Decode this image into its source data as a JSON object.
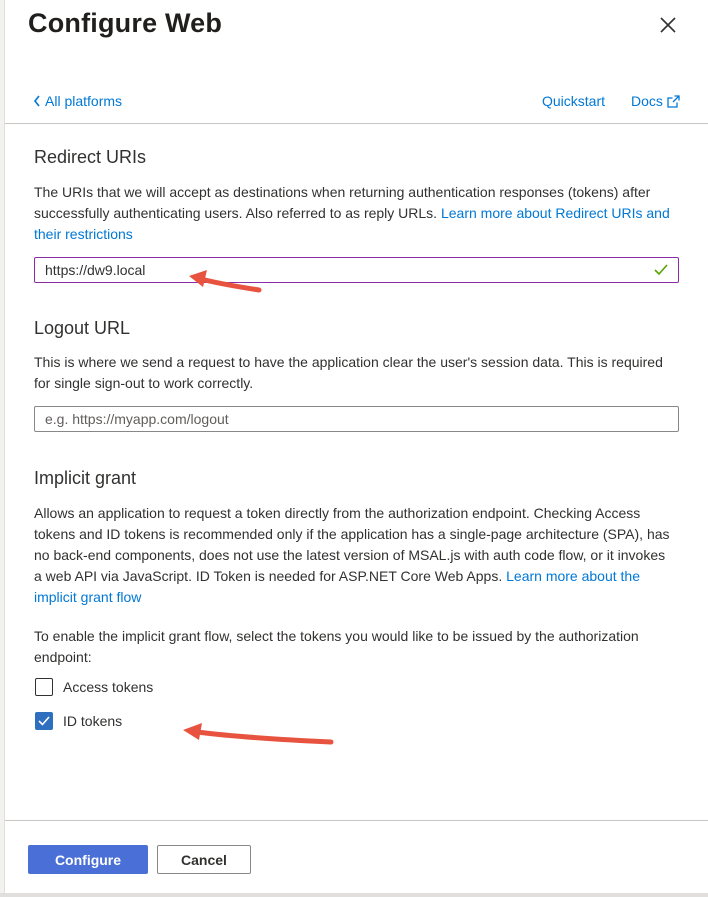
{
  "dialog": {
    "title": "Configure Web",
    "back_link": "All platforms",
    "quickstart_link": "Quickstart",
    "docs_link": "Docs"
  },
  "redirect": {
    "heading": "Redirect URIs",
    "description": "The URIs that we will accept as destinations when returning authentication responses (tokens) after successfully authenticating users. Also referred to as reply URLs. ",
    "learn_more": "Learn more about Redirect URIs and their restrictions",
    "value": "https://dw9.local"
  },
  "logout": {
    "heading": "Logout URL",
    "description": "This is where we send a request to have the application clear the user's session data. This is required for single sign-out to work correctly.",
    "placeholder": "e.g. https://myapp.com/logout"
  },
  "implicit": {
    "heading": "Implicit grant",
    "description": "Allows an application to request a token directly from the authorization endpoint. Checking Access tokens and ID tokens is recommended only if the application has a single-page architecture (SPA), has no back-end components, does not use the latest version of MSAL.js with auth code flow, or it invokes a web API via JavaScript. ID Token is needed for ASP.NET Core Web Apps. ",
    "learn_more": "Learn more about the implicit grant flow",
    "instruction": "To enable the implicit grant flow, select the tokens you would like to be issued by the authorization endpoint:",
    "access_tokens": {
      "label": "Access tokens",
      "checked": false
    },
    "id_tokens": {
      "label": "ID tokens",
      "checked": true
    }
  },
  "footer": {
    "configure_label": "Configure",
    "cancel_label": "Cancel"
  },
  "colors": {
    "accent": "#0078d4",
    "primary_button": "#4a6fd6",
    "focus_border": "#8a2da5",
    "valid_check": "#57a300",
    "annotation_arrow": "#e8533f"
  },
  "icons": [
    "close-icon",
    "chevron-left-icon",
    "external-link-icon",
    "checkmark-icon",
    "annotation-arrow"
  ]
}
